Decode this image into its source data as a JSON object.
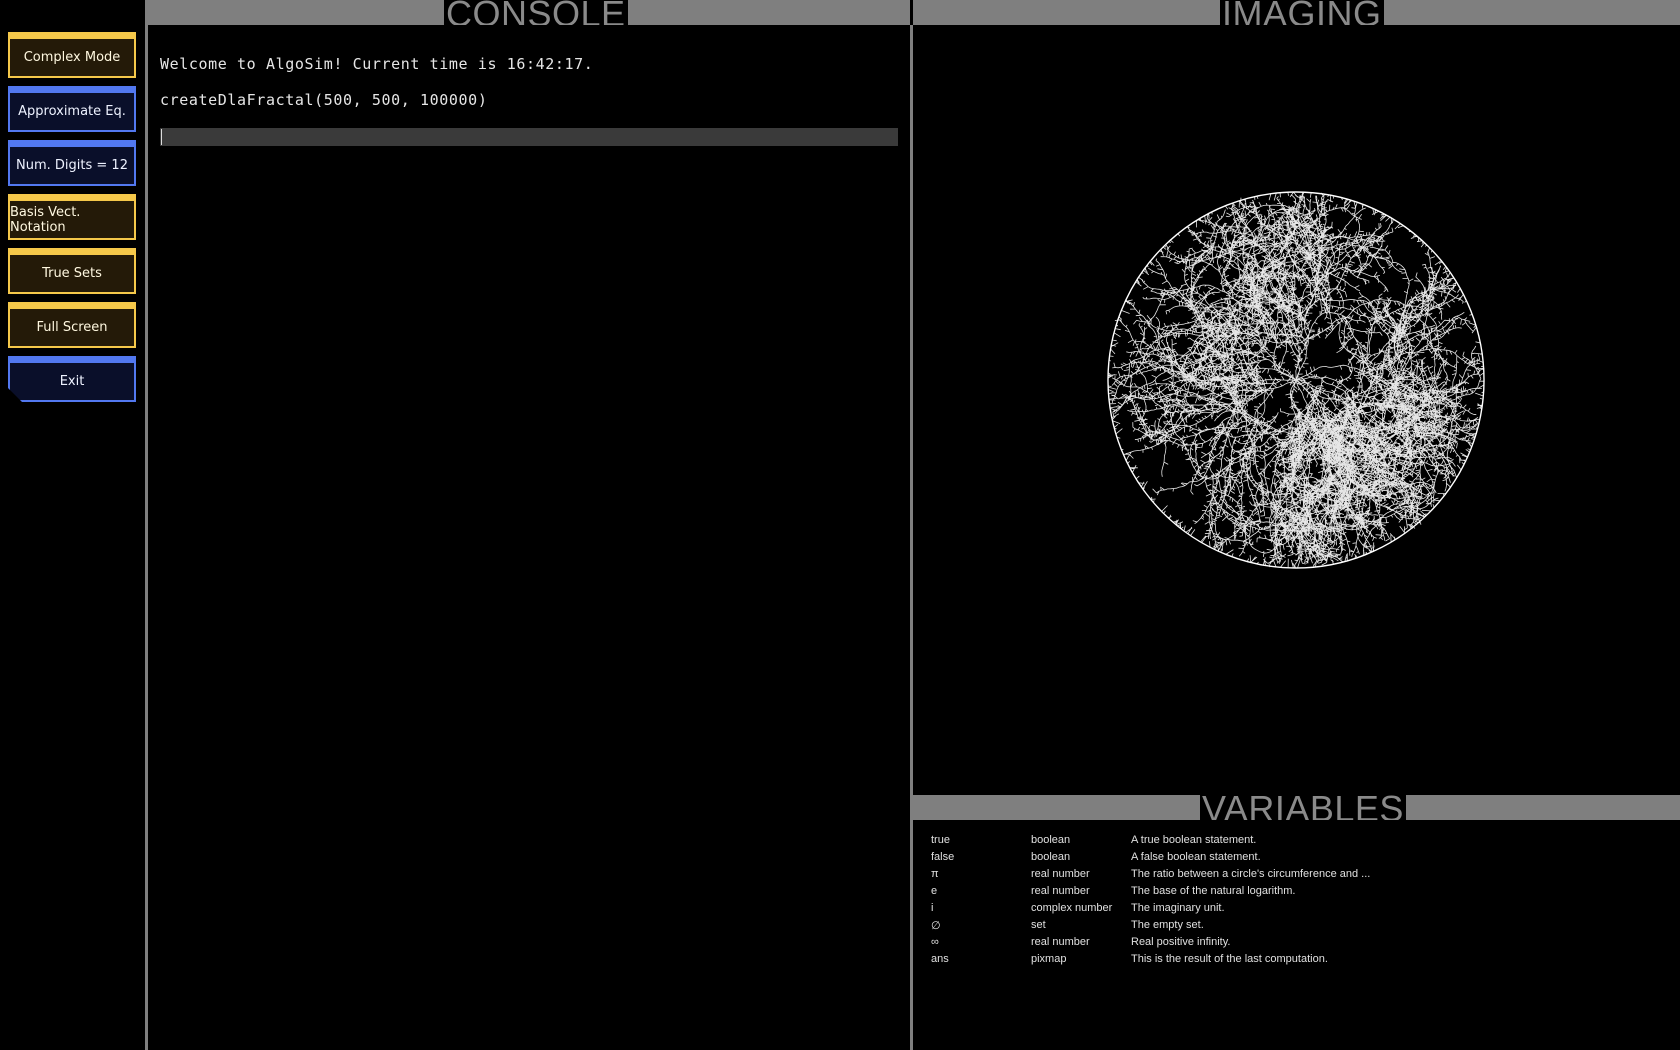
{
  "sidebar": {
    "buttons": [
      {
        "label": "Complex Mode",
        "style": "yellow"
      },
      {
        "label": "Approximate Eq.",
        "style": "blue"
      },
      {
        "label": "Num. Digits = 12",
        "style": "blue"
      },
      {
        "label": "Basis Vect. Notation",
        "style": "yellow"
      },
      {
        "label": "True Sets",
        "style": "yellow"
      },
      {
        "label": "Full Screen",
        "style": "yellow"
      },
      {
        "label": "Exit",
        "style": "blue"
      }
    ]
  },
  "console": {
    "title": "CONSOLE",
    "lines": [
      "Welcome to AlgoSim! Current time is 16:42:17.",
      "createDlaFractal(500, 500, 100000)"
    ],
    "input_value": ""
  },
  "imaging": {
    "title": "IMAGING",
    "image": "dla-fractal"
  },
  "variables": {
    "title": "VARIABLES",
    "rows": [
      {
        "name": "true",
        "type": "boolean",
        "description": "A true boolean statement."
      },
      {
        "name": "false",
        "type": "boolean",
        "description": "A false boolean statement."
      },
      {
        "name": "π",
        "type": "real number",
        "description": "The ratio between a circle's circumference and ..."
      },
      {
        "name": "e",
        "type": "real number",
        "description": "The base of the natural logarithm."
      },
      {
        "name": "i",
        "type": "complex number",
        "description": "The imaginary unit."
      },
      {
        "name": "∅",
        "type": "set",
        "description": "The empty set."
      },
      {
        "name": "∞",
        "type": "real number",
        "description": "Real positive infinity."
      },
      {
        "name": "ans",
        "type": "pixmap",
        "description": "This is the result of the last computation."
      }
    ]
  },
  "colors": {
    "background": "#000000",
    "panel_frame": "#7f7f7f",
    "yellow_accent": "#f5c84a",
    "blue_accent": "#5278f0",
    "fractal": "#ffffff"
  }
}
